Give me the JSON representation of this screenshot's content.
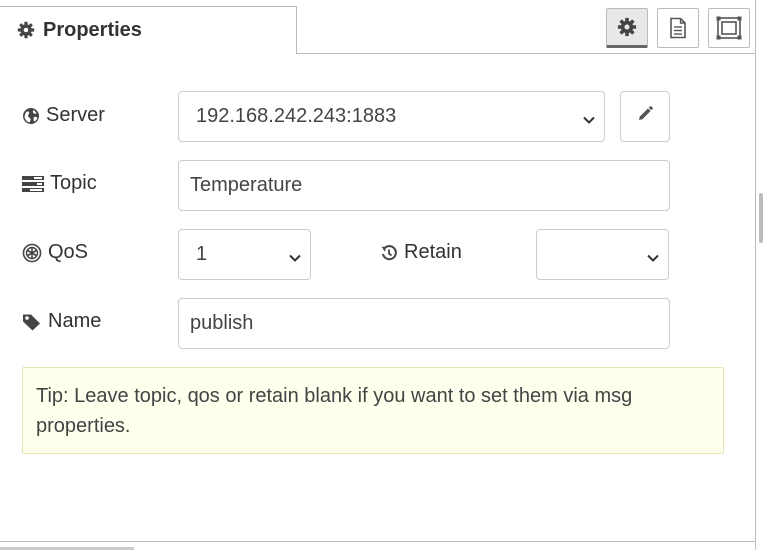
{
  "tabs": {
    "active_label": "Properties",
    "icons": [
      "gear-icon",
      "document-icon",
      "frame-icon"
    ]
  },
  "form": {
    "server": {
      "label": "Server",
      "value": "192.168.242.243:1883",
      "icon": "globe-icon"
    },
    "topic": {
      "label": "Topic",
      "value": "Temperature",
      "icon": "tasks-icon"
    },
    "qos": {
      "label": "QoS",
      "value": "1",
      "icon": "qos-icon"
    },
    "retain": {
      "label": "Retain",
      "value": "",
      "icon": "history-icon"
    },
    "name": {
      "label": "Name",
      "value": "publish",
      "icon": "tag-icon"
    }
  },
  "tip": {
    "text": "Tip: Leave topic, qos or retain blank if you want to set them via msg properties."
  },
  "colors": {
    "tip_background": "#ffffee",
    "border": "#cccccc",
    "text": "#333333"
  }
}
